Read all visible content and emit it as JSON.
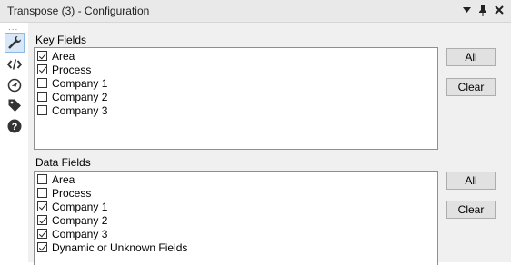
{
  "window": {
    "title": "Transpose (3) - Configuration",
    "controls": [
      {
        "name": "dropdown-icon",
        "glyph": "▾"
      },
      {
        "name": "pin-icon",
        "glyph": "📌"
      },
      {
        "name": "close-icon",
        "glyph": "✕"
      }
    ]
  },
  "sidebar": {
    "dots": "...",
    "icons": [
      "wrench-icon",
      "code-icon",
      "navigate-icon",
      "tag-icon",
      "help-icon"
    ]
  },
  "key_fields": {
    "label": "Key Fields",
    "items": [
      {
        "label": "Area",
        "checked": true
      },
      {
        "label": "Process",
        "checked": true
      },
      {
        "label": "Company 1",
        "checked": false
      },
      {
        "label": "Company 2",
        "checked": false
      },
      {
        "label": "Company 3",
        "checked": false
      }
    ],
    "all_label": "All",
    "clear_label": "Clear"
  },
  "data_fields": {
    "label": "Data Fields",
    "items": [
      {
        "label": "Area",
        "checked": false
      },
      {
        "label": "Process",
        "checked": false
      },
      {
        "label": "Company 1",
        "checked": true
      },
      {
        "label": "Company 2",
        "checked": true
      },
      {
        "label": "Company 3",
        "checked": true
      },
      {
        "label": "Dynamic or Unknown Fields",
        "checked": true
      }
    ],
    "all_label": "All",
    "clear_label": "Clear"
  }
}
